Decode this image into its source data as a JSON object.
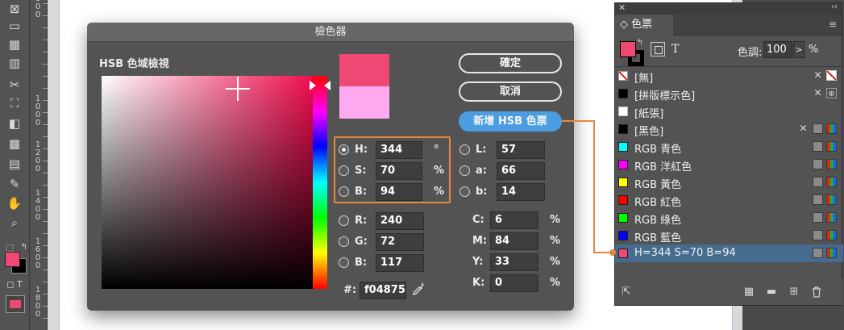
{
  "toolbar": {
    "tools": [
      "frame-grid-icon",
      "rectangle-icon",
      "table-icon",
      "grid-icon",
      "scissors-icon",
      "free-transform-icon",
      "gradient-icon",
      "gradient-feather-icon",
      "note-icon",
      "eyedropper-icon",
      "hand-icon",
      "zoom-icon"
    ]
  },
  "ruler": {
    "marks": [
      "800",
      "1000",
      "1200",
      "1400",
      "1600",
      "1800"
    ]
  },
  "dialog": {
    "title": "檢色器",
    "field_label": "HSB 色域檢視",
    "buttons": {
      "ok": "確定",
      "cancel": "取消",
      "add": "新增 HSB 色票"
    },
    "hsb": [
      {
        "label": "H:",
        "value": "344",
        "unit": "°",
        "selected": true
      },
      {
        "label": "S:",
        "value": "70",
        "unit": "%",
        "selected": false
      },
      {
        "label": "B:",
        "value": "94",
        "unit": "%",
        "selected": false
      }
    ],
    "lab": [
      {
        "label": "L:",
        "value": "57"
      },
      {
        "label": "a:",
        "value": "66"
      },
      {
        "label": "b:",
        "value": "14"
      }
    ],
    "rgb": [
      {
        "label": "R:",
        "value": "240"
      },
      {
        "label": "G:",
        "value": "72"
      },
      {
        "label": "B:",
        "value": "117"
      }
    ],
    "cmyk": [
      {
        "label": "C:",
        "value": "6",
        "unit": "%"
      },
      {
        "label": "M:",
        "value": "84",
        "unit": "%"
      },
      {
        "label": "Y:",
        "value": "33",
        "unit": "%"
      },
      {
        "label": "K:",
        "value": "0",
        "unit": "%"
      }
    ],
    "hex_label": "#:",
    "hex_value": "f04875",
    "colors": {
      "new": "#f04875",
      "old": "#ffaaf0",
      "accent": "#e8883a",
      "button_blue": "#4a9de0"
    }
  },
  "panel": {
    "tab_label": "色票",
    "format_text_label": "T",
    "tint_label": "色調:",
    "tint_value": "100",
    "tint_arrow": ">",
    "tint_unit": "%",
    "swatches": [
      {
        "name": "[無]",
        "color": "none",
        "icons": [
          "no-edit-icon",
          "none-swatch-icon"
        ]
      },
      {
        "name": "[拼版標示色]",
        "color": "#000000",
        "icons": [
          "no-edit-icon",
          "registration-icon"
        ]
      },
      {
        "name": "[紙張]",
        "color": "#ffffff",
        "icons": []
      },
      {
        "name": "[黑色]",
        "color": "#000000",
        "icons": [
          "no-edit-icon",
          "process-icon",
          "rgb-mode-icon"
        ]
      },
      {
        "name": "RGB 青色",
        "color": "#00ffff",
        "icons": [
          "process-icon",
          "rgb-mode-icon"
        ]
      },
      {
        "name": "RGB 洋紅色",
        "color": "#ff00ff",
        "icons": [
          "process-icon",
          "rgb-mode-icon"
        ]
      },
      {
        "name": "RGB 黃色",
        "color": "#ffff00",
        "icons": [
          "process-icon",
          "rgb-mode-icon"
        ]
      },
      {
        "name": "RGB 紅色",
        "color": "#ff0000",
        "icons": [
          "process-icon",
          "rgb-mode-icon"
        ]
      },
      {
        "name": "RGB 綠色",
        "color": "#00ff00",
        "icons": [
          "process-icon",
          "rgb-mode-icon"
        ]
      },
      {
        "name": "RGB 藍色",
        "color": "#0000ff",
        "icons": [
          "process-icon",
          "rgb-mode-icon"
        ]
      },
      {
        "name": "H=344 S=70 B=94",
        "color": "#f04875",
        "icons": [
          "process-icon",
          "rgb-mode-icon"
        ],
        "selected": true
      }
    ],
    "footer_icons": [
      "place-swatch-icon",
      "new-group-icon",
      "folder-icon",
      "new-swatch-icon",
      "trash-icon"
    ]
  }
}
